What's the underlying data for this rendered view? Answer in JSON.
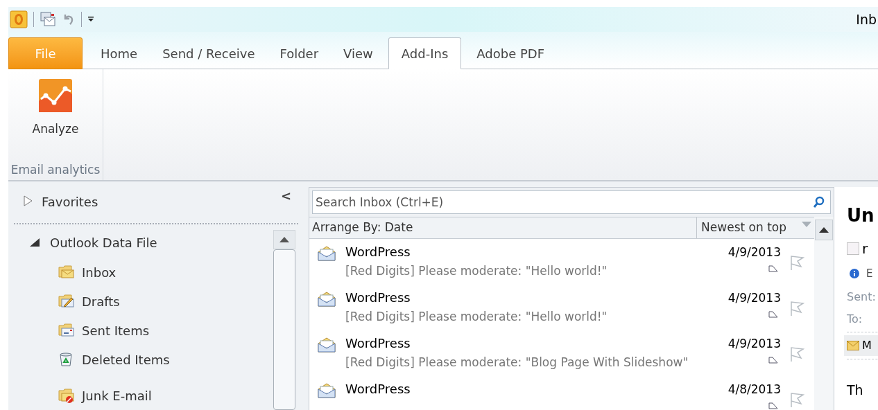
{
  "window": {
    "title": "Inb"
  },
  "tabs": [
    {
      "label": "File",
      "kind": "file",
      "selected": false
    },
    {
      "label": "Home",
      "kind": "tab",
      "selected": false
    },
    {
      "label": "Send / Receive",
      "kind": "tab",
      "selected": false
    },
    {
      "label": "Folder",
      "kind": "tab",
      "selected": false
    },
    {
      "label": "View",
      "kind": "tab",
      "selected": false
    },
    {
      "label": "Add-Ins",
      "kind": "tab",
      "selected": true
    },
    {
      "label": "Adobe PDF",
      "kind": "tab",
      "selected": false
    }
  ],
  "ribbon": {
    "button": "Analyze",
    "group": "Email analytics"
  },
  "navigation": {
    "favorites": {
      "label": "Favorites",
      "expanded": false
    },
    "collapse": "<",
    "data_file": {
      "label": "Outlook Data File",
      "expanded": true,
      "children": [
        {
          "label": "Inbox",
          "kind": "inbox"
        },
        {
          "label": "Drafts",
          "kind": "drafts"
        },
        {
          "label": "Sent Items",
          "kind": "sent"
        },
        {
          "label": "Deleted Items",
          "kind": "deleted"
        },
        {
          "label": "Junk E-mail",
          "kind": "junk"
        }
      ]
    }
  },
  "search": {
    "placeholder": "Search Inbox (Ctrl+E)"
  },
  "arrange": {
    "by": "Arrange By: Date",
    "order": "Newest on top"
  },
  "messages": [
    {
      "sender": "WordPress",
      "date": "4/9/2013",
      "subject": "[Red Digits] Please moderate: \"Hello world!\""
    },
    {
      "sender": "WordPress",
      "date": "4/9/2013",
      "subject": "[Red Digits] Please moderate: \"Hello world!\""
    },
    {
      "sender": "WordPress",
      "date": "4/9/2013",
      "subject": "[Red Digits] Please moderate: \"Blog Page With Slideshow\""
    },
    {
      "sender": "WordPress",
      "date": "4/8/2013"
    }
  ],
  "reading_pane": {
    "subject": "Un",
    "checked": false,
    "checkbox_label": "r",
    "info": "E",
    "sent_label": "Sent:",
    "to_label": "To:",
    "attachment": "M",
    "body": "Th"
  }
}
